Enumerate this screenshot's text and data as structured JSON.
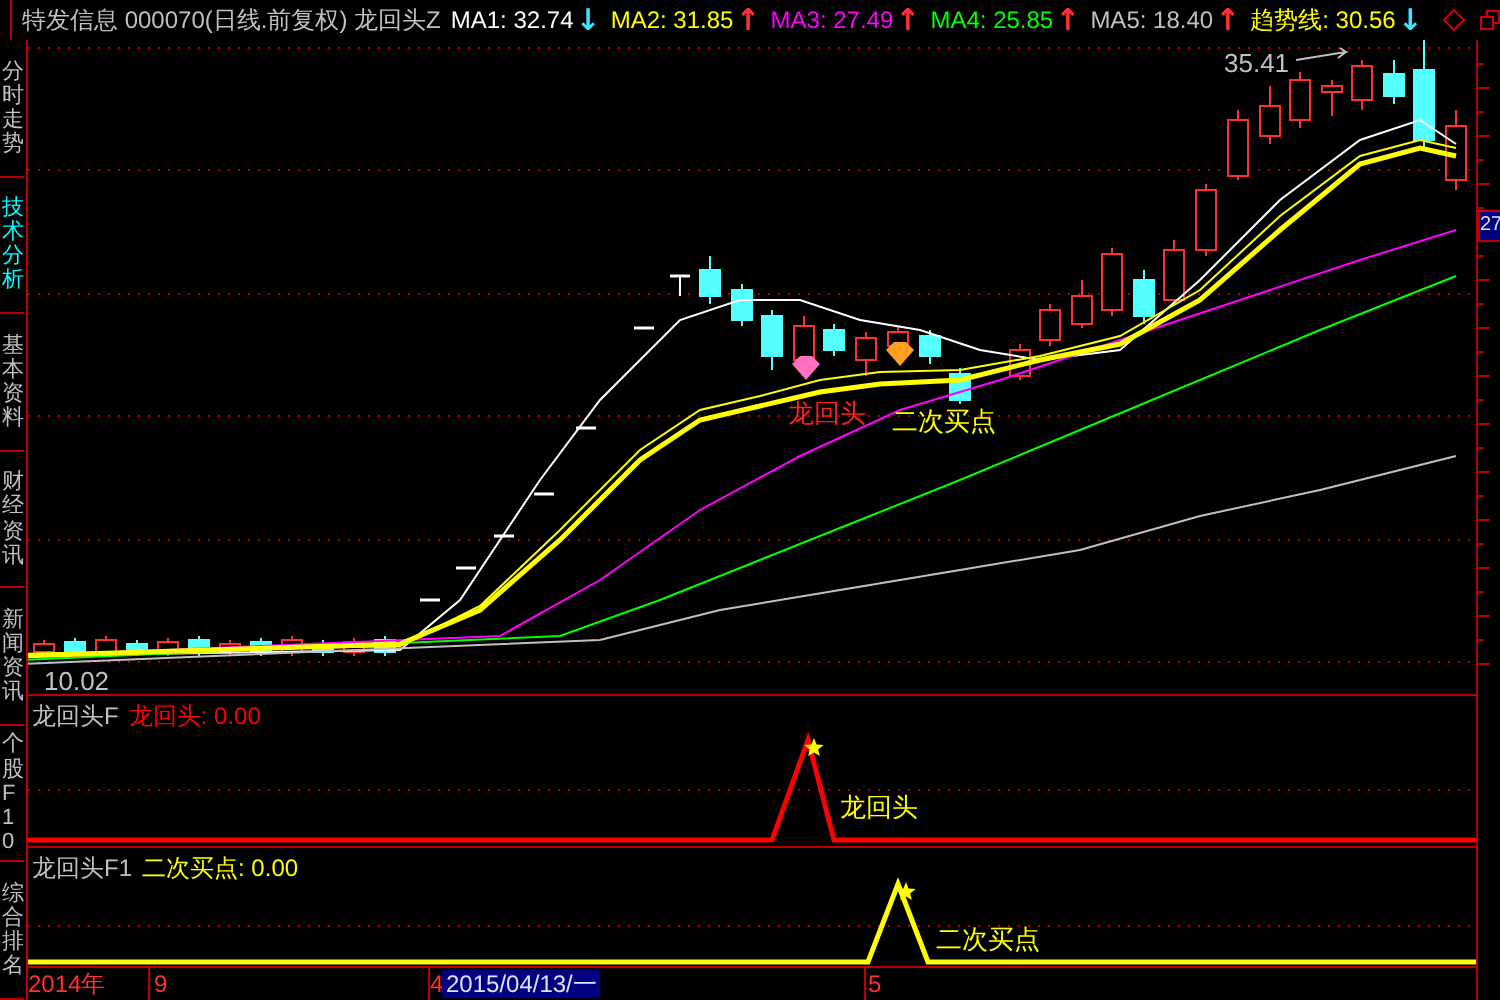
{
  "header": {
    "title": "特发信息 000070(日线.前复权) 龙回头Z",
    "indicators": [
      {
        "label": "MA1: 32.74",
        "color": "#ffffff",
        "arrow": {
          "text": "↓",
          "color": "#40e0ff"
        }
      },
      {
        "label": "MA2: 31.85",
        "color": "#ffff00",
        "arrow": {
          "text": "↑",
          "color": "#ff3030"
        }
      },
      {
        "label": "MA3: 27.49",
        "color": "#ff00ff",
        "arrow": {
          "text": "↑",
          "color": "#ff3030"
        }
      },
      {
        "label": "MA4: 25.85",
        "color": "#00ff00",
        "arrow": {
          "text": "↑",
          "color": "#ff3030"
        }
      },
      {
        "label": "MA5: 18.40",
        "color": "#c0c0c0",
        "arrow": {
          "text": "↑",
          "color": "#ff3030"
        }
      },
      {
        "label": "趋势线: 30.56",
        "color": "#ffff00",
        "arrow": {
          "text": "↓",
          "color": "#40e0ff"
        }
      }
    ]
  },
  "side_tabs": [
    {
      "label": "分时走势",
      "selected": false
    },
    {
      "label": "技术分析",
      "selected": true
    },
    {
      "label": "基本资料",
      "selected": false
    },
    {
      "label": "财经资讯",
      "selected": false
    },
    {
      "label": "新闻资讯",
      "selected": false
    },
    {
      "label": "个股F10",
      "selected": false
    },
    {
      "label": "综合排名",
      "selected": false
    }
  ],
  "main_chart": {
    "high_label": "35.41",
    "low_label": "10.02",
    "price_tag": "27",
    "signals": [
      {
        "kind": "dragon",
        "label": "龙回头"
      },
      {
        "kind": "buy",
        "label": "二次买点"
      }
    ]
  },
  "panels": [
    {
      "name": "龙回头F",
      "reading": "龙回头: 0.00",
      "signal_label": "龙回头",
      "color": "#ff0000"
    },
    {
      "name": "龙回头F1",
      "reading": "二次买点: 0.00",
      "signal_label": "二次买点",
      "color": "#ffff00"
    }
  ],
  "time_axis": [
    {
      "label": "2014年",
      "selected": false
    },
    {
      "label": "9",
      "selected": false
    },
    {
      "label": "4",
      "selected": false
    },
    {
      "label": "2015/04/13/一",
      "selected": true
    },
    {
      "label": "5",
      "selected": false
    }
  ]
}
